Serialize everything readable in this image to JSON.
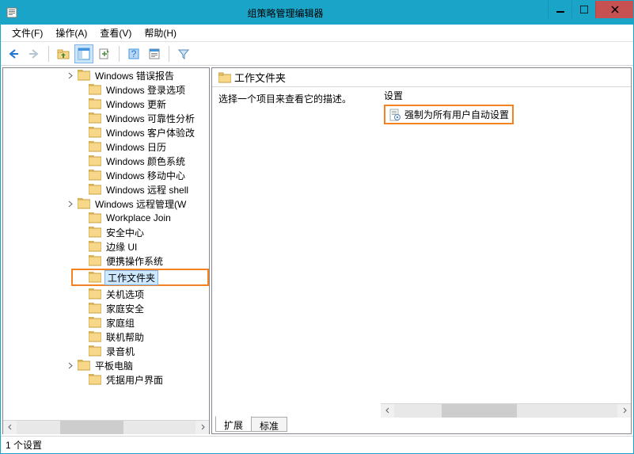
{
  "window": {
    "title": "组策略管理编辑器"
  },
  "menu": {
    "file": "文件(F)",
    "action": "操作(A)",
    "view": "查看(V)",
    "help": "帮助(H)"
  },
  "tree": {
    "items": [
      {
        "label": "Windows 错误报告",
        "expander": "collapsed",
        "indent": 78
      },
      {
        "label": "Windows 登录选项",
        "expander": "none",
        "indent": 92
      },
      {
        "label": "Windows 更新",
        "expander": "none",
        "indent": 92
      },
      {
        "label": "Windows 可靠性分析",
        "expander": "none",
        "indent": 92
      },
      {
        "label": "Windows 客户体验改",
        "expander": "none",
        "indent": 92
      },
      {
        "label": "Windows 日历",
        "expander": "none",
        "indent": 92
      },
      {
        "label": "Windows 颜色系统",
        "expander": "none",
        "indent": 92
      },
      {
        "label": "Windows 移动中心",
        "expander": "none",
        "indent": 92
      },
      {
        "label": "Windows 远程 shell",
        "expander": "none",
        "indent": 92
      },
      {
        "label": "Windows 远程管理(W",
        "expander": "collapsed",
        "indent": 78
      },
      {
        "label": "Workplace Join",
        "expander": "none",
        "indent": 92
      },
      {
        "label": "安全中心",
        "expander": "none",
        "indent": 92
      },
      {
        "label": "边缘 UI",
        "expander": "none",
        "indent": 92
      },
      {
        "label": "便携操作系统",
        "expander": "none",
        "indent": 92
      },
      {
        "label": "工作文件夹",
        "expander": "none",
        "indent": 92,
        "selected": true,
        "highlighted": true
      },
      {
        "label": "关机选项",
        "expander": "none",
        "indent": 92
      },
      {
        "label": "家庭安全",
        "expander": "none",
        "indent": 92
      },
      {
        "label": "家庭组",
        "expander": "none",
        "indent": 92
      },
      {
        "label": "联机帮助",
        "expander": "none",
        "indent": 92
      },
      {
        "label": "录音机",
        "expander": "none",
        "indent": 92
      },
      {
        "label": "平板电脑",
        "expander": "collapsed",
        "indent": 78
      },
      {
        "label": "凭据用户界面",
        "expander": "none",
        "indent": 92
      }
    ]
  },
  "right": {
    "header": "工作文件夹",
    "desc": "选择一个项目来查看它的描述。",
    "col_header": "设置",
    "setting": "强制为所有用户自动设置",
    "tab_extended": "扩展",
    "tab_standard": "标准"
  },
  "status": {
    "text": "1 个设置"
  }
}
